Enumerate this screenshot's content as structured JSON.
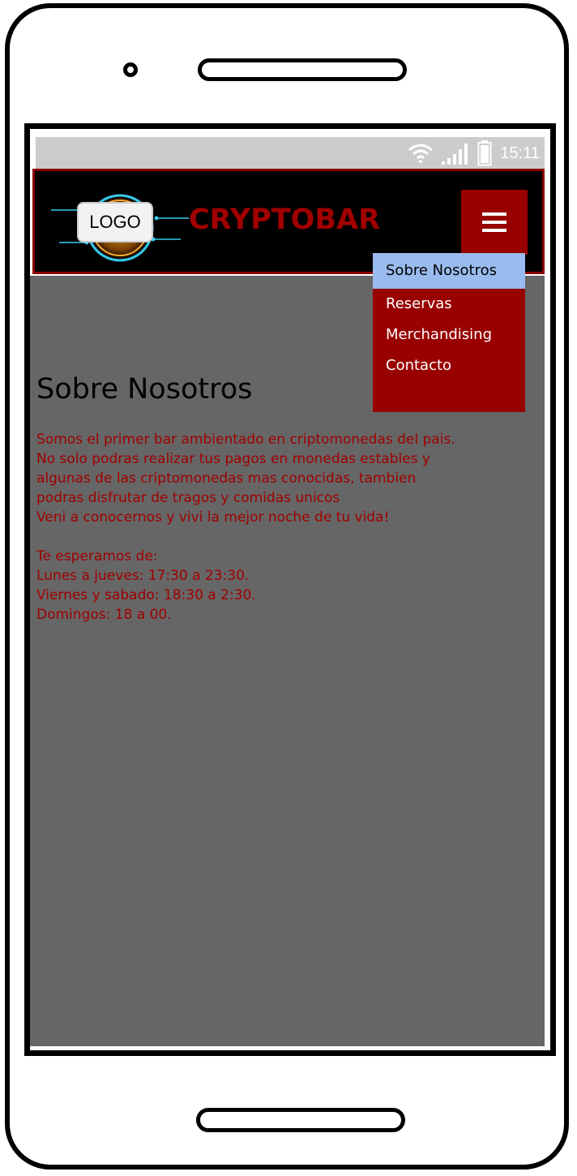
{
  "status_bar": {
    "time": "15:11",
    "icons": [
      "wifi-icon",
      "signal-icon",
      "battery-icon"
    ]
  },
  "header": {
    "logo_text": "LOGO",
    "brand": "CRYPTOBAR",
    "menu_icon": "hamburger-icon"
  },
  "nav_menu": {
    "items": [
      {
        "label": "Sobre Nosotros",
        "active": true
      },
      {
        "label": "Reservas",
        "active": false
      },
      {
        "label": "Merchandising",
        "active": false
      },
      {
        "label": "Contacto",
        "active": false
      }
    ]
  },
  "main": {
    "title": "Sobre Nosotros",
    "paragraphs": [
      "Somos el primer bar ambientado en criptomonedas del pais.",
      "No solo podras realizar tus pagos en monedas estables y algunas de las criptomonedas mas conocidas, tambien podras disfrutar de tragos y comidas unicos",
      "Veni a conocernos y vivi la mejor noche de tu vida!"
    ],
    "schedule_heading": "Te esperamos de:",
    "schedule": [
      "Lunes a jueves: 17:30 a 23:30.",
      "Viernes y sabado: 18:30 a 2:30.",
      "Domingos: 18 a 00."
    ]
  },
  "colors": {
    "brand_red": "#a00000",
    "menu_bg": "#990000",
    "active_item": "#99bbee",
    "content_bg": "#666666"
  }
}
